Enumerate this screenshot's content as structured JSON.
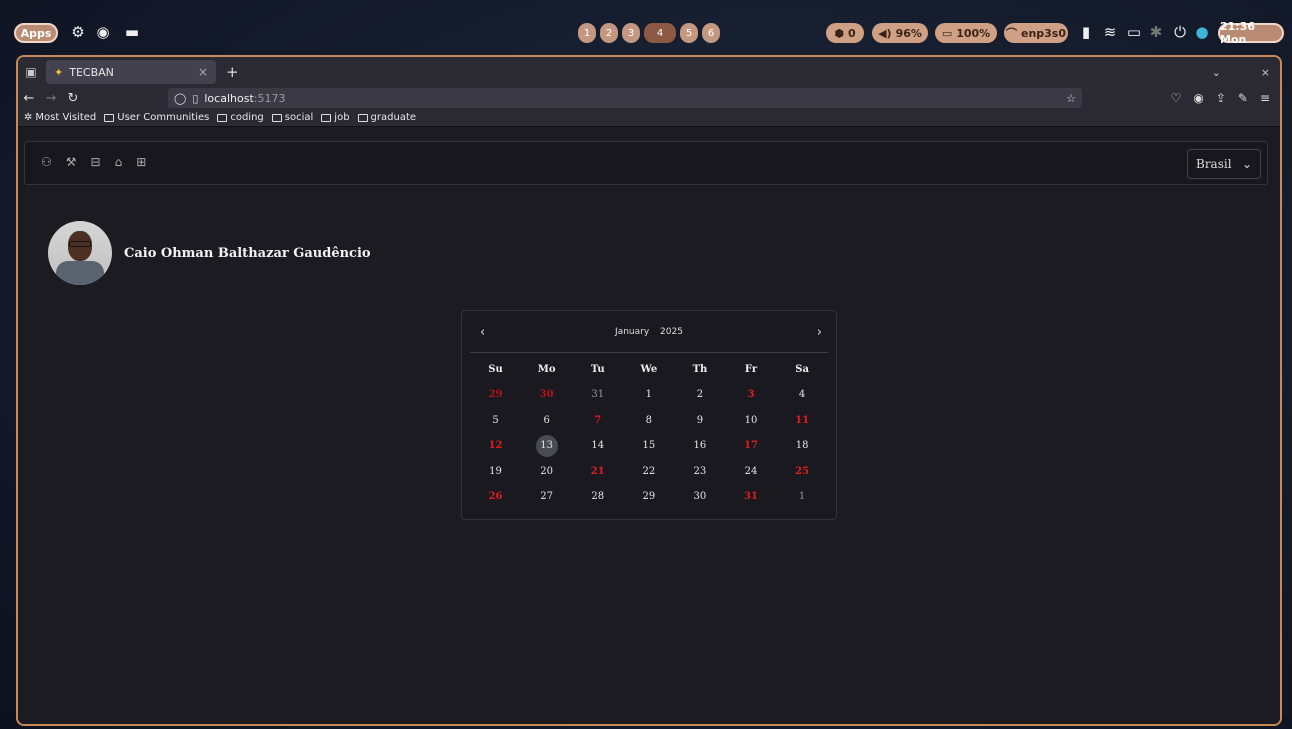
{
  "system_bar": {
    "apps_label": "Apps",
    "workspaces": [
      "1",
      "2",
      "3",
      "4",
      "5",
      "6"
    ],
    "active_workspace": "4",
    "indicators": [
      {
        "name": "updates",
        "icon": "package-icon",
        "text": "0"
      },
      {
        "name": "volume",
        "icon": "speaker-icon",
        "text": "96%"
      },
      {
        "name": "battery",
        "icon": "battery-icon",
        "text": "100%"
      },
      {
        "name": "network",
        "icon": "wifi-icon",
        "text": "enp3s0"
      }
    ],
    "clock": "21:36 Mon"
  },
  "browser": {
    "tab": {
      "title": "TECBAN",
      "favicon": "star-icon"
    },
    "url": {
      "host": "localhost",
      "port": ":5173"
    },
    "bookmarks": [
      {
        "label": "Most Visited",
        "icon": "gear-icon"
      },
      {
        "label": "User Communities",
        "icon": "folder-icon"
      },
      {
        "label": "coding",
        "icon": "folder-icon"
      },
      {
        "label": "social",
        "icon": "folder-icon"
      },
      {
        "label": "job",
        "icon": "folder-icon"
      },
      {
        "label": "graduate",
        "icon": "folder-icon"
      }
    ]
  },
  "app": {
    "nav_icons": [
      "user-icon",
      "wrench-icon",
      "briefcase-icon",
      "bank-icon",
      "car-icon"
    ],
    "country_select": "Brasil",
    "profile_name": "Caio Ohman Balthazar Gaudêncio"
  },
  "calendar": {
    "month": "January",
    "year": "2025",
    "weekdays": [
      "Su",
      "Mo",
      "Tu",
      "We",
      "Th",
      "Fr",
      "Sa"
    ],
    "weeks": [
      [
        {
          "d": "29",
          "red": true,
          "out": true
        },
        {
          "d": "30",
          "red": true,
          "out": true
        },
        {
          "d": "31",
          "out": true
        },
        {
          "d": "1"
        },
        {
          "d": "2"
        },
        {
          "d": "3",
          "red": true
        },
        {
          "d": "4"
        }
      ],
      [
        {
          "d": "5"
        },
        {
          "d": "6"
        },
        {
          "d": "7",
          "red": true
        },
        {
          "d": "8"
        },
        {
          "d": "9"
        },
        {
          "d": "10"
        },
        {
          "d": "11",
          "red": true
        }
      ],
      [
        {
          "d": "12",
          "red": true
        },
        {
          "d": "13",
          "today": true
        },
        {
          "d": "14"
        },
        {
          "d": "15"
        },
        {
          "d": "16"
        },
        {
          "d": "17",
          "red": true
        },
        {
          "d": "18"
        }
      ],
      [
        {
          "d": "19"
        },
        {
          "d": "20"
        },
        {
          "d": "21",
          "red": true
        },
        {
          "d": "22"
        },
        {
          "d": "23"
        },
        {
          "d": "24"
        },
        {
          "d": "25",
          "red": true
        }
      ],
      [
        {
          "d": "26",
          "red": true
        },
        {
          "d": "27"
        },
        {
          "d": "28"
        },
        {
          "d": "29"
        },
        {
          "d": "30"
        },
        {
          "d": "31",
          "red": true
        },
        {
          "d": "1",
          "out": true
        }
      ]
    ]
  },
  "colors": {
    "window_border": "#c98a5a",
    "holiday_red": "#e11d1d",
    "page_bg": "#1c1b22"
  }
}
